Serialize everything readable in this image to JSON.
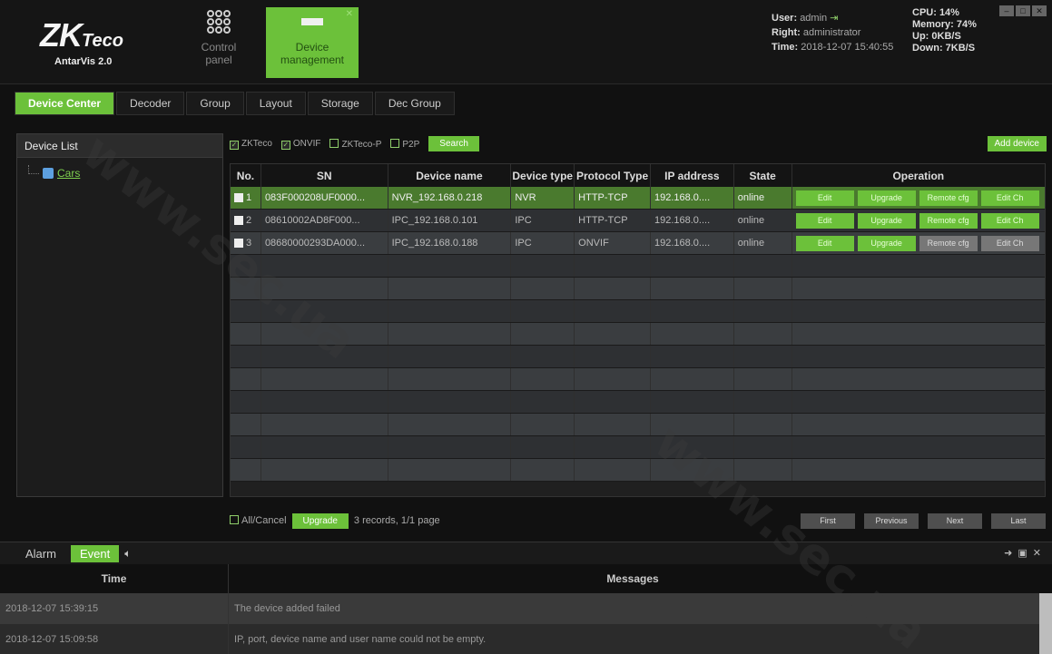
{
  "header": {
    "brand": "ZKTeco",
    "product": "AntarVis 2.0",
    "nav": [
      {
        "label": "Control panel",
        "active": false
      },
      {
        "label": "Device management",
        "active": true
      }
    ],
    "user_label": "User:",
    "user_value": "admin",
    "right_label": "Right:",
    "right_value": "administrator",
    "time_label": "Time:",
    "time_value": "2018-12-07 15:40:55",
    "cpu": "CPU: 14%",
    "memory": "Memory: 74%",
    "up": "Up: 0KB/S",
    "down": "Down: 7KB/S"
  },
  "tabs": [
    "Device Center",
    "Decoder",
    "Group",
    "Layout",
    "Storage",
    "Dec Group"
  ],
  "device_list": {
    "title": "Device List",
    "root": "Cars"
  },
  "filters": {
    "options": [
      {
        "label": "ZKTeco",
        "checked": true
      },
      {
        "label": "ONVIF",
        "checked": true
      },
      {
        "label": "ZKTeco-P",
        "checked": false
      },
      {
        "label": "P2P",
        "checked": false
      }
    ],
    "search_label": "Search",
    "add_device_label": "Add device"
  },
  "table": {
    "columns": [
      "No.",
      "SN",
      "Device name",
      "Device type",
      "Protocol Type",
      "IP address",
      "State",
      "Operation"
    ],
    "rows": [
      {
        "no": "1",
        "sn": "083F000208UF0000...",
        "name": "NVR_192.168.0.218",
        "type": "NVR",
        "protocol": "HTTP-TCP",
        "ip": "192.168.0....",
        "state": "online",
        "selected": true
      },
      {
        "no": "2",
        "sn": "08610002AD8F000...",
        "name": "IPC_192.168.0.101",
        "type": "IPC",
        "protocol": "HTTP-TCP",
        "ip": "192.168.0....",
        "state": "online",
        "selected": false
      },
      {
        "no": "3",
        "sn": "08680000293DA000...",
        "name": "IPC_192.168.0.188",
        "type": "IPC",
        "protocol": "ONVIF",
        "ip": "192.168.0....",
        "state": "online",
        "selected": false
      }
    ],
    "ops": [
      "Edit",
      "Upgrade",
      "Remote cfg",
      "Edit Ch"
    ]
  },
  "pager": {
    "select_all": "All/Cancel",
    "upgrade": "Upgrade",
    "summary": "3 records, 1/1 page",
    "first": "First",
    "previous": "Previous",
    "next": "Next",
    "last": "Last"
  },
  "bottom": {
    "tabs": [
      "Alarm",
      "Event"
    ],
    "columns": [
      "Time",
      "Messages"
    ],
    "rows": [
      {
        "time": "2018-12-07 15:39:15",
        "message": "The device added failed"
      },
      {
        "time": "2018-12-07 15:09:58",
        "message": "IP, port, device name and user name could not be empty."
      }
    ]
  },
  "watermark": "www.sec.ua"
}
